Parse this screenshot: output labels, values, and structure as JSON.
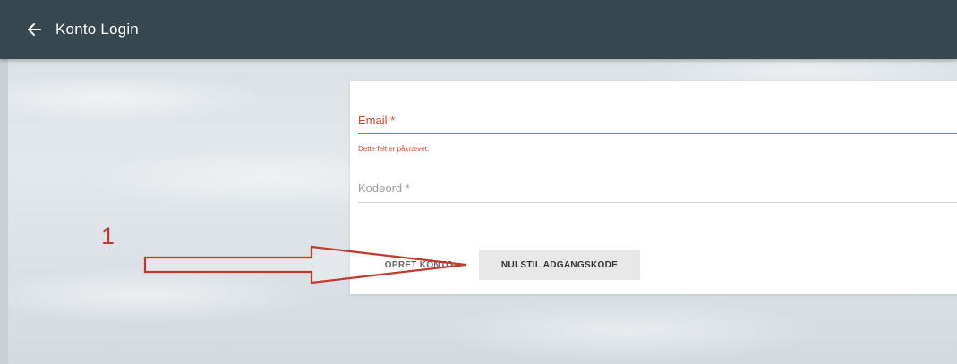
{
  "app_bar": {
    "title": "Konto Login",
    "back_icon": "arrow-left-icon",
    "color": "#37474f"
  },
  "form": {
    "email": {
      "label": "Email *",
      "error": "Dette felt er påkrævet."
    },
    "password": {
      "label": "Kodeord *"
    },
    "buttons": {
      "create_account": "OPRET KONTO",
      "reset_password": "NULSTIL ADGANGSKODE"
    },
    "error_color": "#d9442a"
  },
  "annotation": {
    "step_number": "1",
    "arrow_color": "#c0392b"
  }
}
